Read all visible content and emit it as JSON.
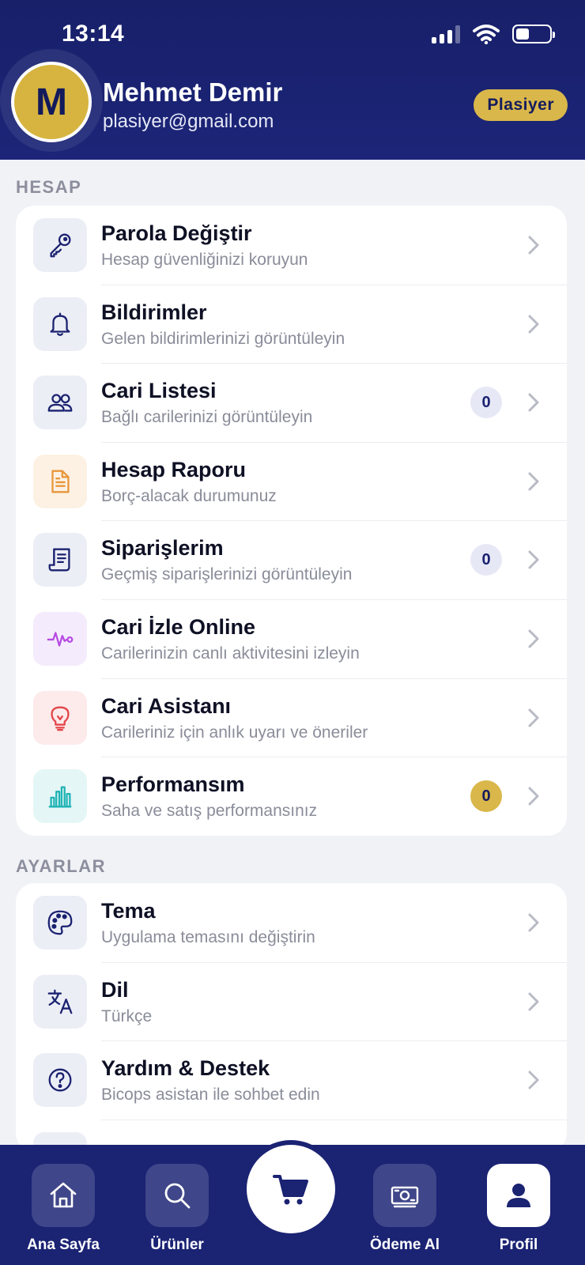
{
  "status_bar": {
    "time": "13:14"
  },
  "profile": {
    "initial": "M",
    "name": "Mehmet Demir",
    "email": "plasiyer@gmail.com",
    "role": "Plasiyer"
  },
  "sections": {
    "account": {
      "title": "HESAP",
      "items": [
        {
          "title": "Parola Değiştir",
          "subtitle": "Hesap güvenliğinizi koruyun",
          "icon": "key-icon"
        },
        {
          "title": "Bildirimler",
          "subtitle": "Gelen bildirimlerinizi görüntüleyin",
          "icon": "bell-icon"
        },
        {
          "title": "Cari Listesi",
          "subtitle": "Bağlı carilerinizi görüntüleyin",
          "icon": "users-icon",
          "badge": "0"
        },
        {
          "title": "Hesap Raporu",
          "subtitle": "Borç-alacak durumunuz",
          "icon": "document-icon"
        },
        {
          "title": "Siparişlerim",
          "subtitle": "Geçmiş siparişlerinizi görüntüleyin",
          "icon": "receipt-icon",
          "badge": "0"
        },
        {
          "title": "Cari İzle Online",
          "subtitle": "Carilerinizin canlı aktivitesini izleyin",
          "icon": "activity-icon"
        },
        {
          "title": "Cari Asistanı",
          "subtitle": "Carileriniz için anlık uyarı ve öneriler",
          "icon": "lightbulb-icon"
        },
        {
          "title": "Performansım",
          "subtitle": "Saha ve satış performansınız",
          "icon": "bar-chart-icon",
          "badge": "0"
        }
      ]
    },
    "settings": {
      "title": "AYARLAR",
      "items": [
        {
          "title": "Tema",
          "subtitle": "Uygulama temasını değiştirin",
          "icon": "palette-icon"
        },
        {
          "title": "Dil",
          "subtitle": "Türkçe",
          "icon": "translate-icon"
        },
        {
          "title": "Yardım & Destek",
          "subtitle": "Bicops asistan ile sohbet edin",
          "icon": "help-icon"
        }
      ]
    }
  },
  "bottom_nav": {
    "home": "Ana Sayfa",
    "products": "Ürünler",
    "payment": "Ödeme Al",
    "profile": "Profil"
  },
  "colors": {
    "header_bg": "#18206a",
    "accent_gold": "#d9b74a",
    "nav_bg": "#1b2373",
    "page_bg": "#f1f2f6"
  }
}
